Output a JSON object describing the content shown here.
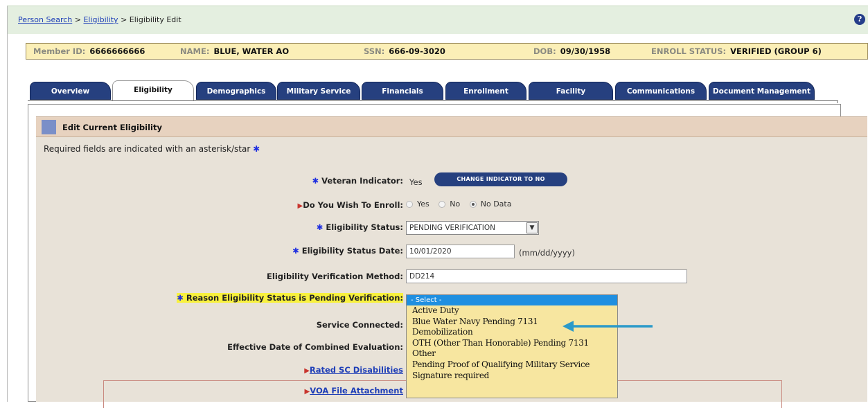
{
  "breadcrumb": {
    "items": [
      "Person Search",
      "Eligibility"
    ],
    "sep": ">",
    "current": "Eligibility Edit"
  },
  "help_icon": "?",
  "member": {
    "id_label": "Member ID:",
    "id_value": "6666666666",
    "name_label": "NAME:",
    "name_value": "BLUE, WATER AO",
    "ssn_label": "SSN:",
    "ssn_value": "666-09-3020",
    "dob_label": "DOB:",
    "dob_value": "09/30/1958",
    "enroll_label": "ENROLL STATUS:",
    "enroll_value": "VERIFIED (GROUP 6)"
  },
  "tabs": [
    "Overview",
    "Eligibility",
    "Demographics",
    "Military Service",
    "Financials",
    "Enrollment",
    "Facility",
    "Communications",
    "Document Management"
  ],
  "active_tab": "Eligibility",
  "section": {
    "title": "Edit Current Eligibility",
    "required_note": "Required fields are indicated with an asterisk/star"
  },
  "form": {
    "veteran_indicator_label": "Veteran Indicator:",
    "veteran_indicator_value": "Yes",
    "change_button": "CHANGE INDICATOR TO NO",
    "enroll_label": "Do You Wish To Enroll:",
    "enroll_options": [
      "Yes",
      "No",
      "No Data"
    ],
    "enroll_selected": "No Data",
    "elig_status_label": "Eligibility Status:",
    "elig_status_value": "PENDING VERIFICATION",
    "elig_date_label": "Eligibility Status Date:",
    "elig_date_value": "10/01/2020",
    "elig_date_hint": "(mm/dd/yyyy)",
    "verification_label": "Eligibility Verification Method:",
    "verification_value": "DD214",
    "reason_label": "Reason Eligibility Status is Pending Verification:",
    "service_connected_label": "Service Connected:",
    "effective_date_label": "Effective Date of Combined Evaluation:",
    "rated_link": "Rated SC Disabilities",
    "voa_link": "VOA File Attachment"
  },
  "dropdown": {
    "selected": "- Select -",
    "options": [
      "Active Duty",
      "Blue Water Navy Pending 7131",
      "Demobilization",
      "OTH (Other Than Honorable) Pending 7131",
      "Other",
      "Pending Proof of Qualifying Military Service",
      "Signature required"
    ]
  },
  "colors": {
    "tab_blue": "#26407f",
    "highlight": "#f8f13e",
    "dropdown_bg": "#f7e6a0",
    "select_blue": "#1f8fe0",
    "pointer_arrow": "#2b9ac9"
  }
}
